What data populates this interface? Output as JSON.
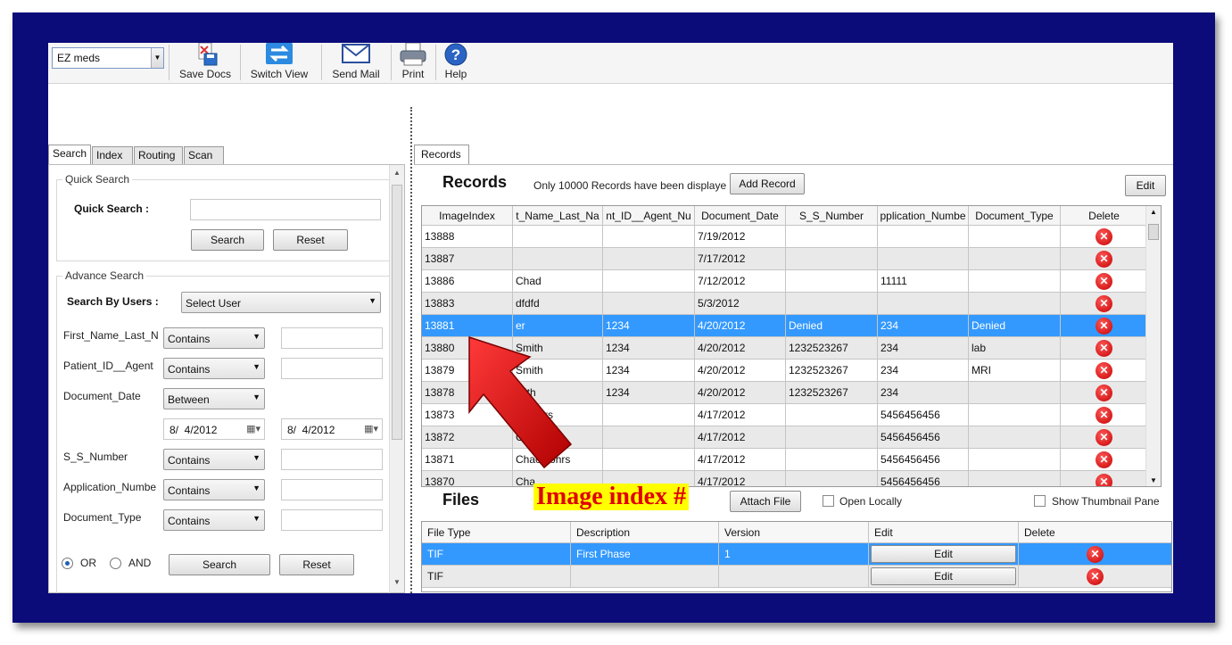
{
  "toolbar": {
    "app_select": "EZ meds",
    "buttons": [
      {
        "label": "Save Docs",
        "icon": "save-docs-icon"
      },
      {
        "label": "Switch View",
        "icon": "switch-view-icon"
      },
      {
        "label": "Send Mail",
        "icon": "mail-icon"
      },
      {
        "label": "Print",
        "icon": "printer-icon"
      },
      {
        "label": "Help",
        "icon": "help-icon"
      }
    ]
  },
  "left_tabs": [
    "Search",
    "Index",
    "Routing",
    "Scan"
  ],
  "quick_search": {
    "group_label": "Quick Search",
    "label": "Quick Search :",
    "value": "",
    "search_button": "Search",
    "reset_button": "Reset"
  },
  "advance_search": {
    "group_label": "Advance Search",
    "by_users_label": "Search By Users :",
    "user_select": "Select User",
    "fields": [
      {
        "label": "First_Name_Last_N",
        "operator": "Contains",
        "value": ""
      },
      {
        "label": "Patient_ID__Agent",
        "operator": "Contains",
        "value": ""
      },
      {
        "label": "Document_Date",
        "operator": "Between",
        "date_from": "8/  4/2012",
        "date_to": "8/  4/2012"
      },
      {
        "label": "S_S_Number",
        "operator": "Contains",
        "value": ""
      },
      {
        "label": "Application_Numbe",
        "operator": "Contains",
        "value": ""
      },
      {
        "label": "Document_Type",
        "operator": "Contains",
        "value": ""
      }
    ],
    "or_label": "OR",
    "and_label": "AND",
    "logic_selected": "OR",
    "search_button": "Search",
    "reset_button": "Reset"
  },
  "records": {
    "tab": "Records",
    "title": "Records",
    "notice": "Only 10000 Records have been displaye",
    "add_button": "Add Record",
    "edit_button": "Edit",
    "columns": [
      "ImageIndex",
      "t_Name_Last_Na",
      "nt_ID__Agent_Nu",
      "Document_Date",
      "S_S_Number",
      "pplication_Numbe",
      "Document_Type",
      "Delete"
    ],
    "rows": [
      [
        "13888",
        "",
        "",
        "7/19/2012",
        "",
        "",
        ""
      ],
      [
        "13887",
        "",
        "",
        "7/17/2012",
        "",
        "",
        ""
      ],
      [
        "13886",
        "Chad",
        "",
        "7/12/2012",
        "",
        "11111",
        ""
      ],
      [
        "13883",
        "dfdfd",
        "",
        "5/3/2012",
        "",
        "",
        ""
      ],
      [
        "13881",
        "er",
        "1234",
        "4/20/2012",
        "Denied",
        "234",
        "Denied"
      ],
      [
        "13880",
        "Smith",
        "1234",
        "4/20/2012",
        "1232523267",
        "234",
        "lab"
      ],
      [
        "13879",
        "Smith",
        "1234",
        "4/20/2012",
        "1232523267",
        "234",
        "MRI"
      ],
      [
        "13878",
        "mith",
        "1234",
        "4/20/2012",
        "1232523267",
        "234",
        ""
      ],
      [
        "13873",
        "d Cohrs",
        "",
        "4/17/2012",
        "",
        "5456456456",
        ""
      ],
      [
        "13872",
        "C    ohrs",
        "",
        "4/17/2012",
        "",
        "5456456456",
        ""
      ],
      [
        "13871",
        "Chac   ohrs",
        "",
        "4/17/2012",
        "",
        "5456456456",
        ""
      ],
      [
        "13870",
        "Cha",
        "",
        "4/17/2012",
        "",
        "5456456456",
        ""
      ]
    ],
    "selected_row": 4
  },
  "files": {
    "title": "Files",
    "attach_button": "Attach File",
    "open_locally": "Open Locally",
    "show_thumbnail": "Show Thumbnail Pane",
    "columns": [
      "File Type",
      "Description",
      "Version",
      "Edit",
      "Delete"
    ],
    "rows": [
      {
        "type": "TIF",
        "description": "First Phase",
        "version": "1",
        "edit": "Edit"
      },
      {
        "type": "TIF",
        "description": "",
        "version": "",
        "edit": "Edit"
      }
    ]
  },
  "annotation": "Image index #",
  "colors": {
    "frame": "#0b0b7a",
    "selection": "#3399ff",
    "annotation_bg": "#ffff00",
    "annotation_text": "#e00000",
    "arrow": "#d00000"
  }
}
